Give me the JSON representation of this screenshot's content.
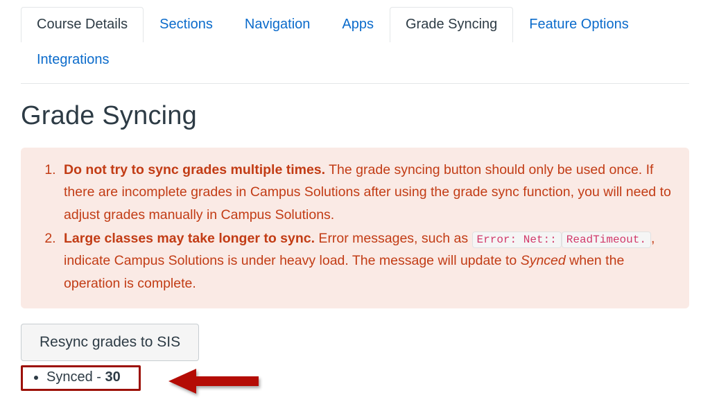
{
  "tabs": {
    "items": [
      {
        "label": "Course Details",
        "style": "boxed"
      },
      {
        "label": "Sections",
        "style": "link"
      },
      {
        "label": "Navigation",
        "style": "link"
      },
      {
        "label": "Apps",
        "style": "link"
      },
      {
        "label": "Grade Syncing",
        "style": "boxed"
      },
      {
        "label": "Feature Options",
        "style": "link"
      },
      {
        "label": "Integrations",
        "style": "link"
      }
    ]
  },
  "page": {
    "title": "Grade Syncing"
  },
  "warning": {
    "items": [
      {
        "bold_lead": "Do not try to sync grades multiple times.",
        "body": " The grade syncing button should only be used once. If there are incomplete grades in Campus Solutions after using the grade sync function, you will need to adjust grades manually in Campus Solutions."
      },
      {
        "bold_lead": "Large classes may take longer to sync.",
        "body_part1": " Error messages, such as ",
        "code1": "Error: Net::",
        "code2": "ReadTimeout.",
        "body_part2": ", indicate Campus Solutions is under heavy load. The message will update to ",
        "italic": "Synced",
        "body_part3": " when the operation is complete."
      }
    ]
  },
  "actions": {
    "resync_button_label": "Resync grades to SIS"
  },
  "status": {
    "label": "Synced - ",
    "count": "30"
  },
  "annotation": {
    "arrow_name": "left-arrow-annotation",
    "arrow_color": "#b40c05",
    "highlight_color": "#9c1006"
  },
  "colors": {
    "link": "#0b6bcb",
    "heading": "#2D3B45",
    "warning_bg": "#faeae5",
    "warning_text": "#c23c15",
    "code_text": "#d1396a"
  }
}
